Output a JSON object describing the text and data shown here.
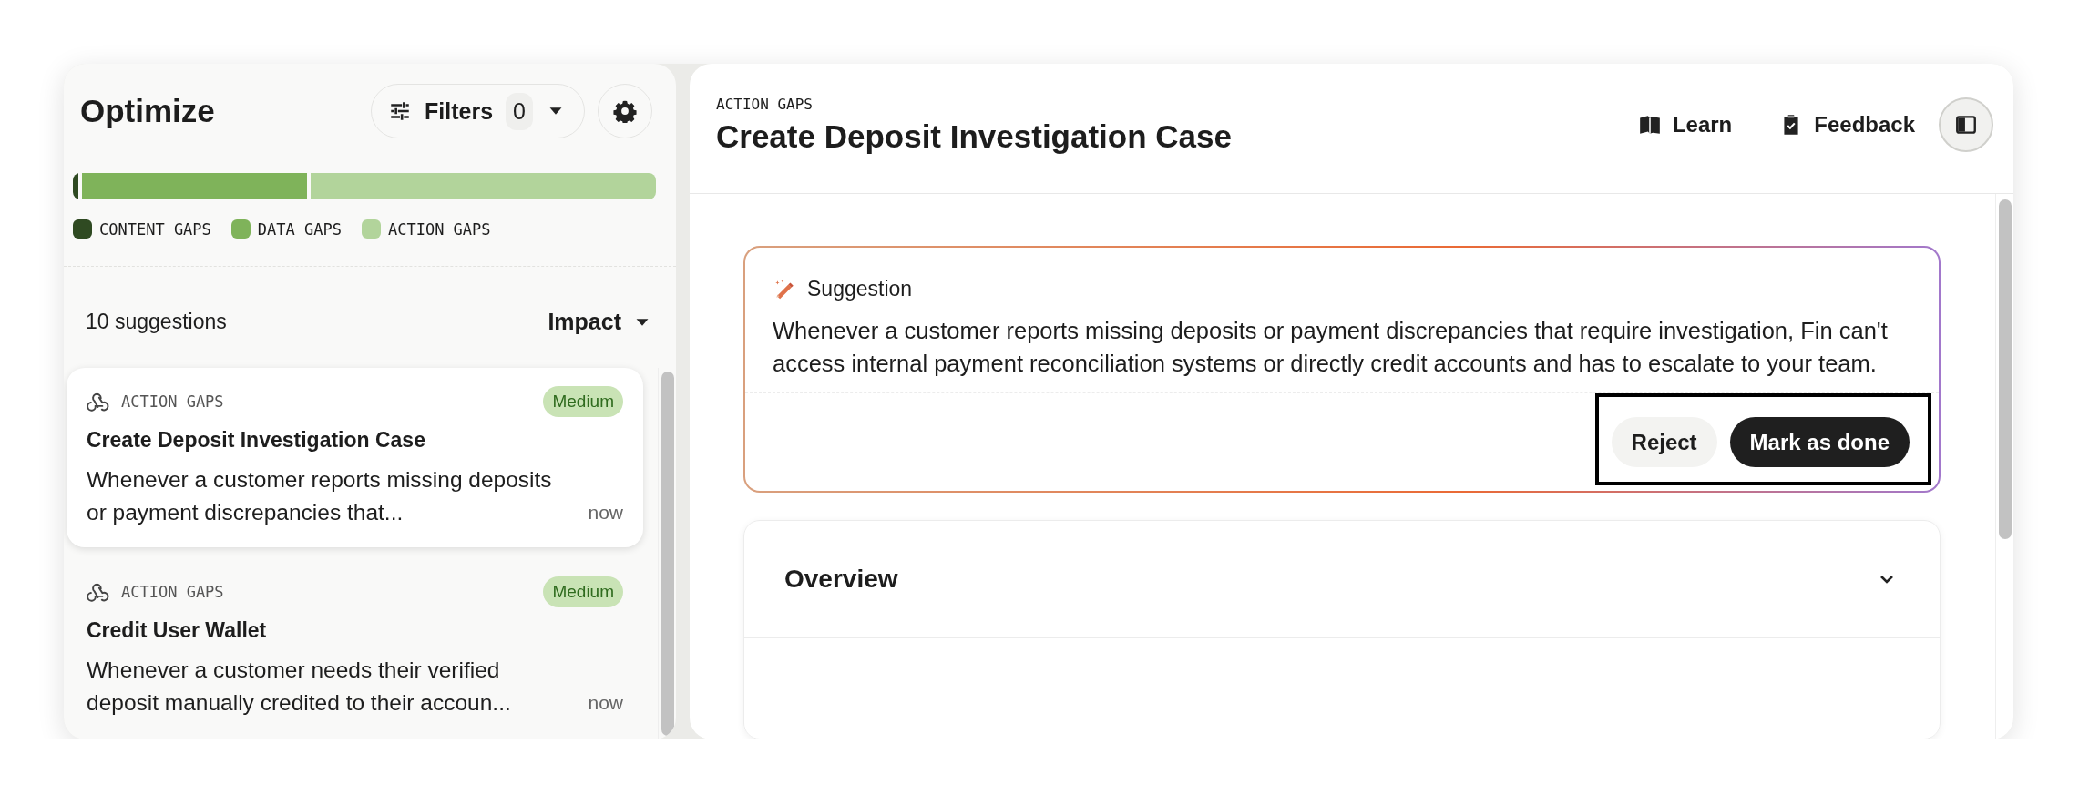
{
  "sidebar": {
    "title": "Optimize",
    "filters": {
      "label": "Filters",
      "count": "0"
    },
    "breakdown": [
      {
        "label": "CONTENT GAPS",
        "color": "#2f4a22"
      },
      {
        "label": "DATA GAPS",
        "color": "#7fb35a"
      },
      {
        "label": "ACTION GAPS",
        "color": "#b2d49b"
      }
    ],
    "count": "10 suggestions",
    "sort": "Impact",
    "items": [
      {
        "category": "ACTION GAPS",
        "badge": "Medium",
        "title": "Create Deposit Investigation Case",
        "summary": "Whenever a customer reports missing deposits or payment discrepancies that...",
        "time": "now",
        "selected": true
      },
      {
        "category": "ACTION GAPS",
        "badge": "Medium",
        "title": "Credit User Wallet",
        "summary": "Whenever a customer needs their verified deposit manually credited to their accoun...",
        "time": "now",
        "selected": false
      }
    ]
  },
  "detail": {
    "category": "ACTION GAPS",
    "title": "Create Deposit Investigation Case",
    "actions": [
      "Learn",
      "Feedback"
    ],
    "suggestion": {
      "label": "Suggestion",
      "text": "Whenever a customer reports missing deposits or payment discrepancies that require investigation, Fin can't access internal payment reconciliation systems or directly credit accounts and has to escalate to your team.",
      "buttons": [
        {
          "label": "Reject",
          "kind": "secondary"
        },
        {
          "label": "Mark as done",
          "kind": "primary"
        }
      ],
      "buttons_highlighted": true
    },
    "sections": [
      {
        "title": "Overview",
        "expanded": false
      }
    ]
  }
}
